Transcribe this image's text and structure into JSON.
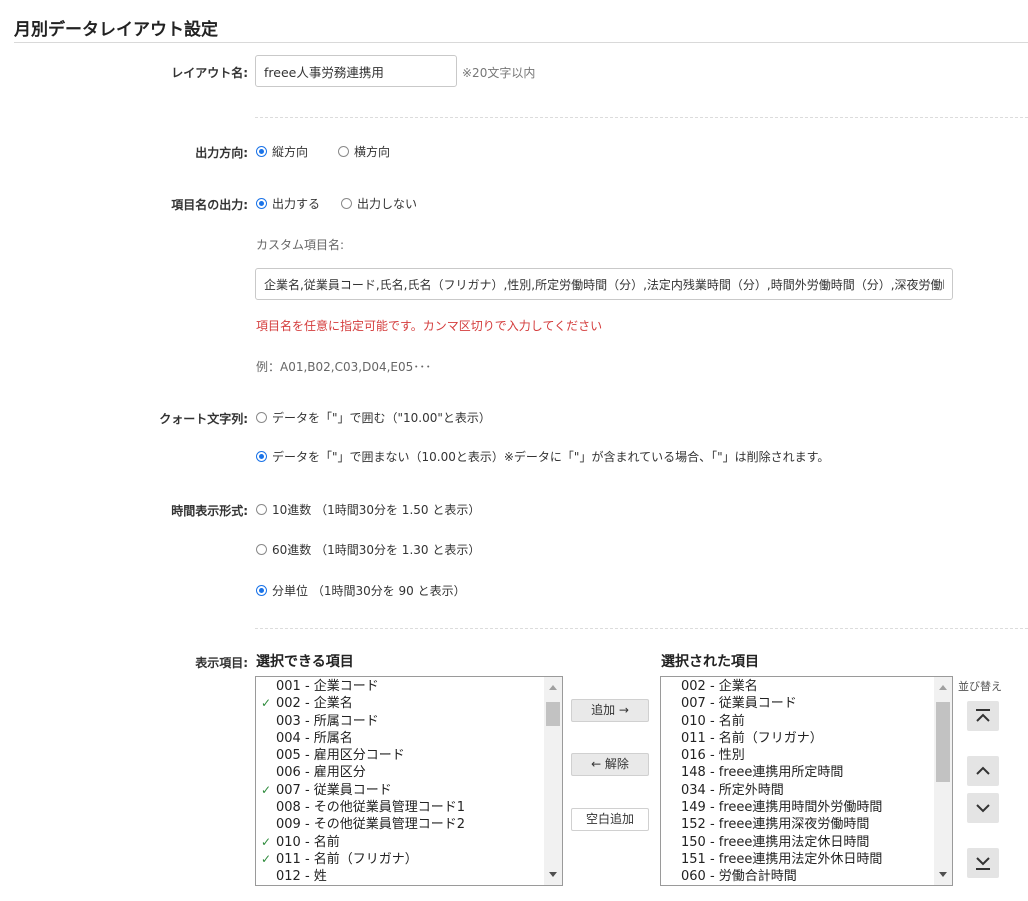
{
  "page": {
    "title": "月別データレイアウト設定"
  },
  "layout_name": {
    "label": "レイアウト名:",
    "value": "freee人事労務連携用",
    "hint": "※20文字以内"
  },
  "output_direction": {
    "label": "出力方向:",
    "options": [
      {
        "label": "縦方向",
        "selected": true
      },
      {
        "label": "横方向",
        "selected": false
      }
    ]
  },
  "header_output": {
    "label": "項目名の出力:",
    "options": [
      {
        "label": "出力する",
        "selected": true
      },
      {
        "label": "出力しない",
        "selected": false
      }
    ],
    "custom_label": "カスタム項目名:",
    "custom_value": "企業名,従業員コード,氏名,氏名（フリガナ）,性別,所定労働時間（分）,法定内残業時間（分）,時間外労働時間（分）,深夜労働時間（分）",
    "error": "項目名を任意に指定可能です。カンマ区切りで入力してください",
    "example": "例：A01,B02,C03,D04,E05･･･"
  },
  "quote": {
    "label": "クォート文字列:",
    "options": [
      {
        "label": "データを「\"」で囲む（\"10.00\"と表示）",
        "selected": false
      },
      {
        "label": "データを「\"」で囲まない（10.00と表示）※データに「\"」が含まれている場合、「\"」は削除されます。",
        "selected": true
      }
    ]
  },
  "time_format": {
    "label": "時間表示形式:",
    "options": [
      {
        "label": "10進数 （1時間30分を 1.50 と表示）",
        "selected": false
      },
      {
        "label": "60進数 （1時間30分を 1.30 と表示）",
        "selected": false
      },
      {
        "label": "分単位 （1時間30分を 90 と表示）",
        "selected": true
      }
    ]
  },
  "display_items": {
    "label": "表示項目:",
    "available_heading": "選択できる項目",
    "selected_heading": "選択された項目",
    "sort_label": "並び替え",
    "add_button": "追加 →",
    "remove_button": "← 解除",
    "blank_button": "空白追加",
    "available": [
      {
        "text": "001 - 企業コード",
        "checked": false
      },
      {
        "text": "002 - 企業名",
        "checked": true
      },
      {
        "text": "003 - 所属コード",
        "checked": false
      },
      {
        "text": "004 - 所属名",
        "checked": false
      },
      {
        "text": "005 - 雇用区分コード",
        "checked": false
      },
      {
        "text": "006 - 雇用区分",
        "checked": false
      },
      {
        "text": "007 - 従業員コード",
        "checked": true
      },
      {
        "text": "008 - その他従業員管理コード1",
        "checked": false
      },
      {
        "text": "009 - その他従業員管理コード2",
        "checked": false
      },
      {
        "text": "010 - 名前",
        "checked": true
      },
      {
        "text": "011 - 名前（フリガナ）",
        "checked": true
      },
      {
        "text": "012 - 姓",
        "checked": false
      }
    ],
    "selected": [
      "002 - 企業名",
      "007 - 従業員コード",
      "010 - 名前",
      "011 - 名前（フリガナ）",
      "016 - 性別",
      "148 - freee連携用所定時間",
      "034 - 所定外時間",
      "149 - freee連携用時間外労働時間",
      "152 - freee連携用深夜労働時間",
      "150 - freee連携用法定休日時間",
      "151 - freee連携用法定外休日時間",
      "060 - 労働合計時間"
    ]
  },
  "colors": {
    "accent": "#1a73e8",
    "error": "#d43c3c",
    "check": "#2e8b3c"
  }
}
